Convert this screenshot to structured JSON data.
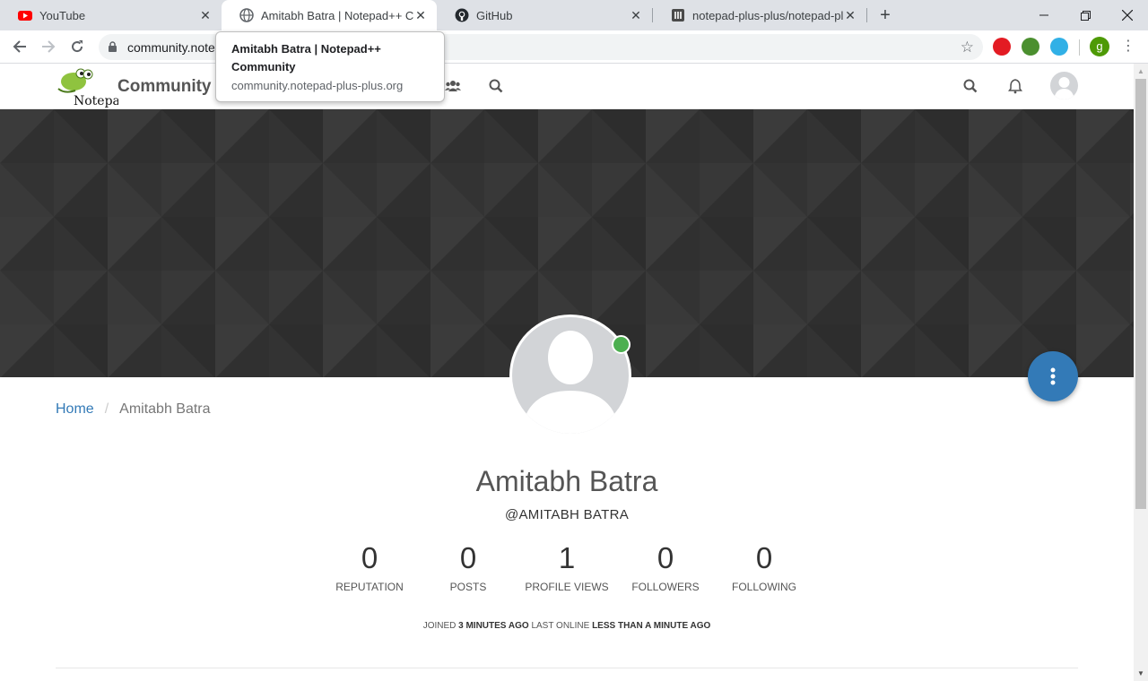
{
  "browser": {
    "tabs": [
      {
        "title": "YouTube",
        "icon": "youtube-icon",
        "active": false
      },
      {
        "title": "Amitabh Batra | Notepad++ Community",
        "icon": "globe-icon",
        "active": true
      },
      {
        "title": "GitHub",
        "icon": "github-icon",
        "active": false
      },
      {
        "title": "notepad-plus-plus/notepad-plus-plus",
        "icon": "repo-icon",
        "active": false
      }
    ],
    "new_tab_label": "+",
    "address": "community.notepad-plus-plus.org",
    "address_visible": "community.note",
    "profile_initial": "g"
  },
  "tooltip": {
    "title": "Amitabh Batra | Notepad++ Community",
    "url": "community.notepad-plus-plus.org"
  },
  "site": {
    "brand": "Community",
    "logo_text": "Notepad++"
  },
  "breadcrumb": {
    "home": "Home",
    "separator": "/",
    "current": "Amitabh Batra"
  },
  "profile": {
    "fullname": "Amitabh Batra",
    "handle": "@AMITABH BATRA",
    "online": true,
    "stats": [
      {
        "value": "0",
        "label": "REPUTATION"
      },
      {
        "value": "0",
        "label": "POSTS"
      },
      {
        "value": "1",
        "label": "PROFILE VIEWS"
      },
      {
        "value": "0",
        "label": "FOLLOWERS"
      },
      {
        "value": "0",
        "label": "FOLLOWING"
      }
    ],
    "joined_label": "JOINED",
    "joined_value": "3 MINUTES AGO",
    "last_online_label": "LAST ONLINE",
    "last_online_value": "LESS THAN A MINUTE AGO"
  },
  "colors": {
    "accent": "#337ab7",
    "online": "#4caf50",
    "cover": "#333333"
  }
}
